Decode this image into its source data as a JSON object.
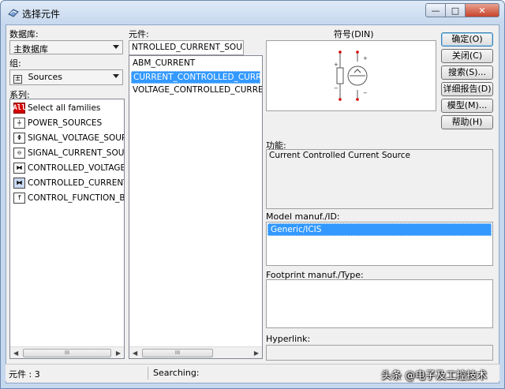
{
  "window": {
    "title": "选择元件",
    "min_glyph": "—",
    "max_glyph": "□",
    "close_glyph": "✕"
  },
  "database": {
    "label": "数据库:",
    "value": "主数据库"
  },
  "group": {
    "label": "组:",
    "value": "Sources",
    "icon": "sources-icon"
  },
  "family": {
    "label": "系列:",
    "items": [
      {
        "label": "Select all families",
        "icon_text": "All",
        "icon": "all-families-icon"
      },
      {
        "label": "POWER_SOURCES",
        "icon_text": "⏚",
        "icon": "power-sources-icon"
      },
      {
        "label": "SIGNAL_VOLTAGE_SOURC",
        "icon_text": "Φ",
        "icon": "signal-voltage-icon"
      },
      {
        "label": "SIGNAL_CURRENT_SOURC",
        "icon_text": "⊖",
        "icon": "signal-current-icon"
      },
      {
        "label": "CONTROLLED_VOLTAGE_S",
        "icon_text": "⧓",
        "icon": "controlled-voltage-icon"
      },
      {
        "label": "CONTROLLED_CURRENT_S",
        "icon_text": "⧓",
        "icon": "controlled-current-icon"
      },
      {
        "label": "CONTROL_FUNCTION_BLO",
        "icon_text": "f",
        "icon": "control-function-icon"
      }
    ]
  },
  "component": {
    "label": "元件:",
    "value": "NTROLLED_CURRENT_SOURCE",
    "items": [
      {
        "label": "ABM_CURRENT",
        "selected": false
      },
      {
        "label": "CURRENT_CONTROLLED_CURRENT_",
        "selected": true
      },
      {
        "label": "VOLTAGE_CONTROLLED_CURRENT_S",
        "selected": false
      }
    ]
  },
  "symbol": {
    "label": "符号(DIN)"
  },
  "buttons": {
    "ok": "确定(O)",
    "close": "关闭(C)",
    "search": "搜索(S)...",
    "detail": "详细报告(D)",
    "model": "模型(M)...",
    "help": "帮助(H)"
  },
  "function": {
    "label": "功能:",
    "value": "Current Controlled Current Source"
  },
  "model_manuf": {
    "label": "Model manuf./ID:",
    "items": [
      "Generic/ICIS"
    ]
  },
  "footprint": {
    "label": "Footprint manuf./Type:"
  },
  "hyperlink": {
    "label": "Hyperlink:"
  },
  "scroll": {
    "thumb_glyph": "III",
    "left_arrow": "◀",
    "right_arrow": "▶"
  },
  "status": {
    "count": "元件 : 3",
    "searching": "Searching:",
    "watermark": "头条 @电子及工控技术"
  },
  "colors": {
    "selection": "#3399ff",
    "title_gradient": "#dfeaf7"
  }
}
